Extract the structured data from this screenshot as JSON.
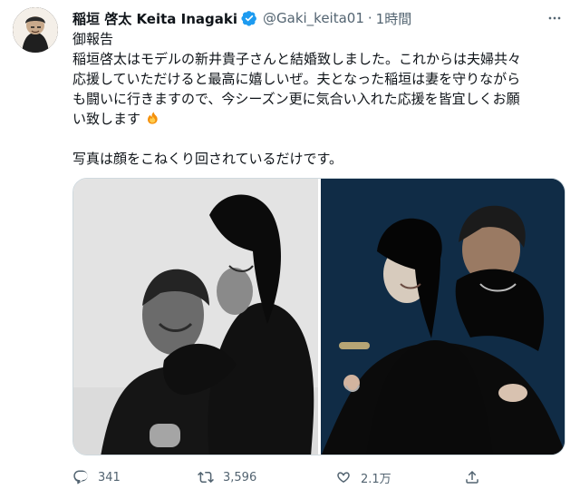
{
  "tweet": {
    "author_name": "稲垣 啓太 Keita Inagaki",
    "handle": "@Gaki_keita01",
    "separator": "·",
    "time": "1時間",
    "lines": [
      "御報告",
      "稲垣啓太はモデルの新井貴子さんと結婚致しました。これからは夫婦共々",
      "応援していただけると最高に嬉しいぜ。夫となった稲垣は妻を守りながら",
      "も闘いに行きますので、今シーズン更に気合い入れた応援を皆宜しくお願",
      "い致します"
    ],
    "second_line": "写真は顔をこねくり回されているだけです。",
    "icons": {
      "verified": "verified-badge-icon",
      "more": "more-icon",
      "emoji": "fire-emoji-icon"
    },
    "colors": {
      "accent": "#1d9bf0",
      "secondary_text": "#536471",
      "text": "#0f1419"
    }
  },
  "actions": {
    "reply_count": "341",
    "retweet_count": "3,596",
    "like_count": "2.1万",
    "icons": [
      "reply-icon",
      "retweet-icon",
      "like-icon",
      "share-icon"
    ]
  }
}
